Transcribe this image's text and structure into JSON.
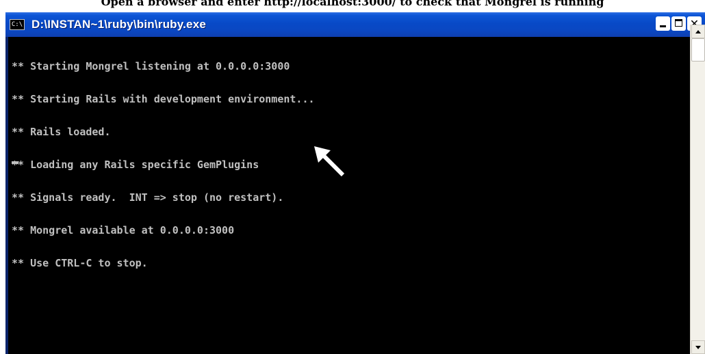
{
  "document": {
    "clipped_text": "Open a browser and enter http://localhost:3000/ to check that Mongrel is running"
  },
  "window": {
    "title": "D:\\INSTAN~1\\ruby\\bin\\ruby.exe",
    "icon": "console-app-icon",
    "icon_text": "C:\\",
    "buttons": {
      "minimize": "minimize-icon",
      "maximize": "maximize-icon",
      "close_glyph": "✕"
    }
  },
  "console": {
    "lines": [
      "** Starting Mongrel listening at 0.0.0.0:3000",
      "** Starting Rails with development environment...",
      "** Rails loaded.",
      "** Loading any Rails specific GemPlugins",
      "** Signals ready.  INT => stop (no restart).",
      "** Mongrel available at 0.0.0.0:3000",
      "** Use CTRL-C to stop."
    ],
    "text_color": "#c0c0c0",
    "background_color": "#000000"
  },
  "annotation": {
    "icon": "pointer-arrow-icon",
    "color": "#ffffff"
  },
  "colors": {
    "titlebar": "#0a47c2",
    "title_text": "#ffffff"
  }
}
